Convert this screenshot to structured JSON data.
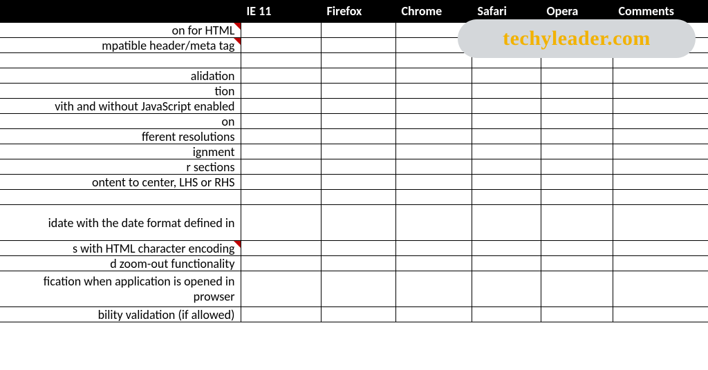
{
  "headers": {
    "desc": "",
    "ie": "IE 11",
    "firefox": "Firefox",
    "chrome": "Chrome",
    "safari": "Safari",
    "opera": "Opera",
    "comments": "Comments"
  },
  "rows": [
    {
      "text": "on for HTML",
      "note": true
    },
    {
      "text": "mpatible header/meta tag",
      "note": true
    },
    {
      "text": ""
    },
    {
      "text": "alidation"
    },
    {
      "text": "tion"
    },
    {
      "text": "vith and without JavaScript enabled"
    },
    {
      "text": "on"
    },
    {
      "text": "fferent resolutions"
    },
    {
      "text": "ignment"
    },
    {
      "text": "r sections"
    },
    {
      "text": "ontent to center, LHS or RHS"
    },
    {
      "text": ""
    },
    {
      "two": true,
      "line1": "idate with the date format defined in",
      "line2": ""
    },
    {
      "text": "s with HTML character encoding",
      "note": true
    },
    {
      "text": "d zoom-out functionality"
    },
    {
      "two": true,
      "line1": "fication when application is opened in",
      "line2": "prowser"
    },
    {
      "text": "bility validation (if allowed)"
    }
  ],
  "watermark": "techyleader.com"
}
